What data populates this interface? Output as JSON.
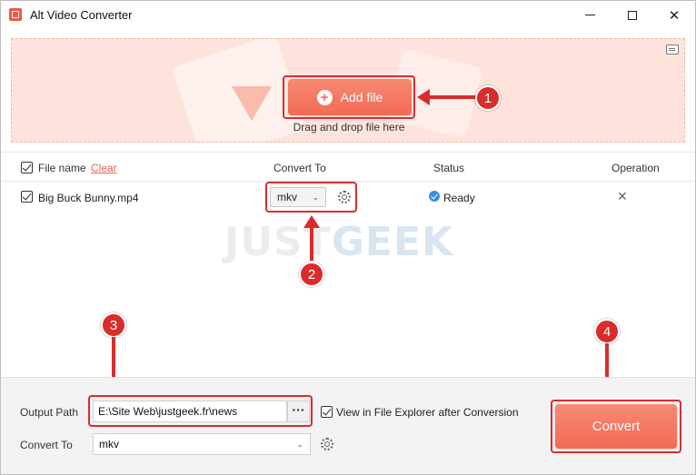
{
  "window": {
    "title": "Alt Video Converter",
    "icon": "video-app-icon"
  },
  "dropzone": {
    "add_file_label": "Add file",
    "hint": "Drag and drop file here"
  },
  "table": {
    "headers": {
      "file_name": "File name",
      "clear": "Clear",
      "convert_to": "Convert To",
      "status": "Status",
      "operation": "Operation"
    },
    "rows": [
      {
        "file_name": "Big Buck Bunny.mp4",
        "format": "mkv",
        "status": "Ready"
      }
    ]
  },
  "watermark": {
    "part1": "JUST",
    "part2": "GEEK"
  },
  "annotations": [
    "1",
    "2",
    "3",
    "4"
  ],
  "bottom": {
    "output_path_label": "Output Path",
    "output_path_value": "E:\\Site Web\\justgeek.fr\\news",
    "browse_label": "···",
    "view_in_explorer_label": "View in File Explorer after Conversion",
    "convert_to_label": "Convert To",
    "convert_to_value": "mkv",
    "convert_button": "Convert"
  },
  "colors": {
    "accent": "#f26a55",
    "annotation": "#d92c2c",
    "status_ready": "#3a8ee6",
    "dropzone_bg": "#fde3dc"
  }
}
